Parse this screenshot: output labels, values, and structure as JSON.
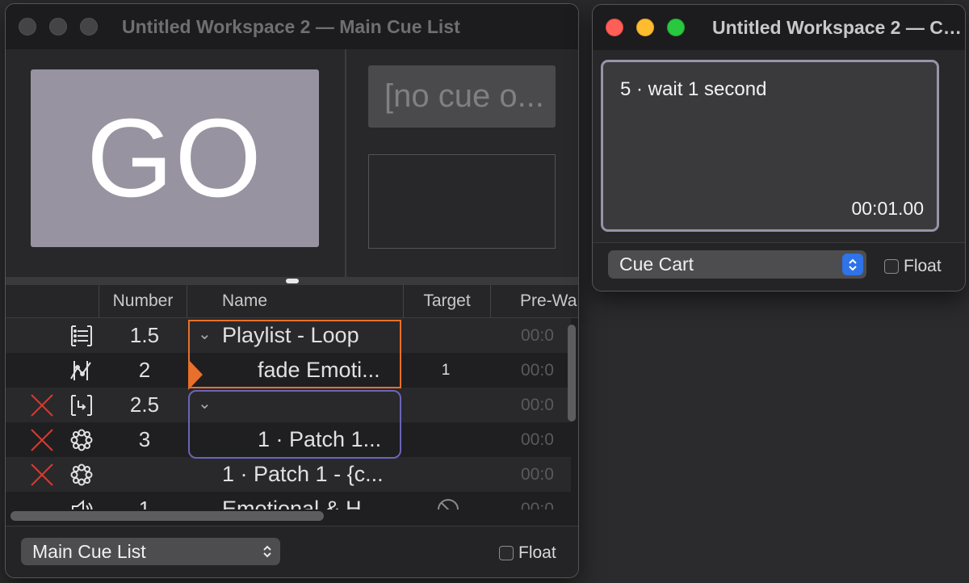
{
  "main_window": {
    "title": "Untitled Workspace 2 — Main Cue List",
    "go_label": "GO",
    "next_cue_text": "[no cue o...",
    "columns": {
      "number": "Number",
      "name": "Name",
      "target": "Target",
      "prewait": "Pre-Wa"
    },
    "rows": [
      {
        "status": "",
        "icon": "group-playlist-icon",
        "number": "1.5",
        "name": "Playlist - Loop",
        "target": "",
        "prewait": "00:0",
        "disclosure": true,
        "indent": 0
      },
      {
        "status": "",
        "icon": "fade-icon",
        "number": "2",
        "name": "fade Emoti...",
        "target": "1",
        "prewait": "00:0",
        "disclosure": false,
        "indent": 1
      },
      {
        "status": "broken",
        "icon": "group-start-icon",
        "number": "2.5",
        "name": "",
        "target": "",
        "prewait": "00:0",
        "disclosure": true,
        "indent": 0
      },
      {
        "status": "broken",
        "icon": "network-icon",
        "number": "3",
        "name": "1 · Patch 1...",
        "target": "",
        "prewait": "00:0",
        "disclosure": false,
        "indent": 1
      },
      {
        "status": "broken",
        "icon": "network-icon",
        "number": "",
        "name": "1 · Patch 1 - {c...",
        "target": "",
        "prewait": "00:0",
        "disclosure": false,
        "indent": 0
      },
      {
        "status": "",
        "icon": "audio-icon",
        "number": "1",
        "name": "Emotional & H...",
        "target": "no-target",
        "prewait": "00:0",
        "disclosure": false,
        "indent": 0
      }
    ],
    "footer": {
      "cue_list_select": "Main Cue List",
      "float_label": "Float",
      "float_checked": false
    }
  },
  "cart_window": {
    "title": "Untitled Workspace 2 — Cu...",
    "cue_name": "5 · wait 1 second",
    "cue_time": "00:01.00",
    "footer": {
      "select": "Cue Cart",
      "float_label": "Float",
      "float_checked": false
    }
  },
  "colors": {
    "go_button": "#9893a0",
    "playhead": "#e8702a",
    "group_border_purple": "#6b64b8",
    "broken_x": "#d83a2e",
    "select_stepper": "#2e73e8",
    "cart_cue_border": "#9a93a9"
  }
}
